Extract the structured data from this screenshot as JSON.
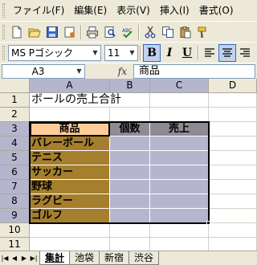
{
  "menubar": {
    "items": [
      "ファイル(F)",
      "編集(E)",
      "表示(V)",
      "挿入(I)",
      "書式(O)"
    ]
  },
  "toolbar": {
    "icons": [
      "new-icon",
      "open-icon",
      "save-icon",
      "permission-icon",
      "print-icon",
      "print-preview-icon",
      "spelling-icon",
      "cut-icon",
      "copy-icon",
      "paste-icon",
      "format-painter-icon"
    ]
  },
  "format_toolbar": {
    "font": "MS Pゴシック",
    "size": "11",
    "bold_label": "B",
    "italic_label": "I",
    "underline_label": "U"
  },
  "formula": {
    "name_box": "A3",
    "fx_label": "fx",
    "value": "商品"
  },
  "sheet": {
    "columns": [
      "A",
      "B",
      "C",
      "D"
    ],
    "rows": [
      "1",
      "2",
      "3",
      "4",
      "5",
      "6",
      "7",
      "8",
      "9",
      "10",
      "11"
    ],
    "title": "ボールの売上合計",
    "header": [
      "商品",
      "個数",
      "売上"
    ],
    "products": [
      "バレーボール",
      "テニス",
      "サッカー",
      "野球",
      "ラグビー",
      "ゴルフ"
    ],
    "colors": {
      "header_product": "#ffcc99",
      "header_other": "#8f8b95",
      "product_fill": "#a57f2e",
      "selection": "#b6b5ce"
    }
  },
  "tabs": {
    "items": [
      "集計",
      "池袋",
      "新宿",
      "渋谷"
    ],
    "active": "集計"
  }
}
